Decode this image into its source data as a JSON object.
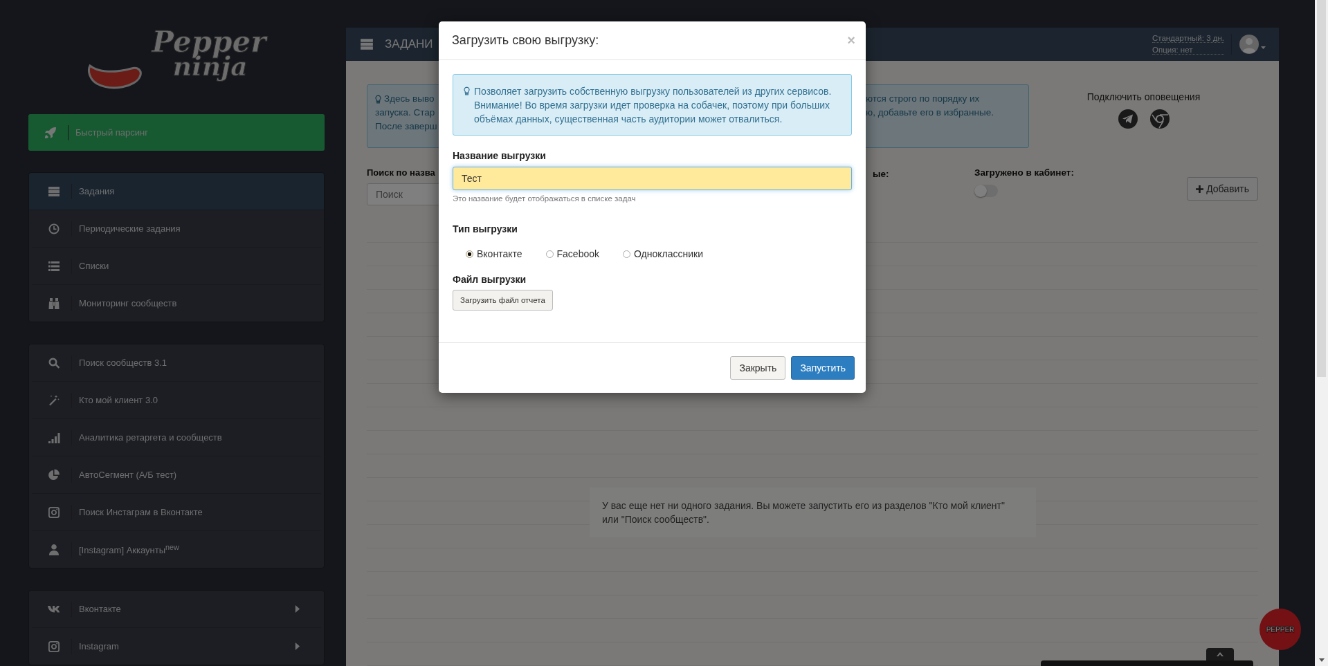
{
  "logo": {
    "line1": "Pepper",
    "line2": "ninja"
  },
  "sidebar": {
    "quick_action": {
      "label": "Быстрый парсинг"
    },
    "groups": [
      {
        "items": [
          {
            "label": "Задания",
            "selected": true
          },
          {
            "label": "Периодические задания",
            "selected": false
          },
          {
            "label": "Списки",
            "selected": false
          },
          {
            "label": "Мониторинг сообществ",
            "selected": false
          }
        ]
      },
      {
        "items": [
          {
            "label": "Поиск сообществ 3.1",
            "selected": false
          },
          {
            "label": "Кто мой клиент 3.0",
            "selected": false
          },
          {
            "label": "Аналитика ретаргета и сообществ",
            "selected": false
          },
          {
            "label": "АвтоСегмент (А/Б тест)",
            "selected": false
          },
          {
            "label": "Поиск Инстаграм в Вконтакте",
            "selected": false
          },
          {
            "label": "[Instagram] Аккаунты$^{new}$",
            "selected": false
          }
        ]
      },
      {
        "items": [
          {
            "label": "Вконтакте",
            "selected": false,
            "expanded": false
          },
          {
            "label": "Instagram",
            "selected": false,
            "expanded": false
          }
        ]
      }
    ]
  },
  "header": {
    "title": "ЗАДАНИ",
    "plan": "Стандартный: 3 дн.",
    "option": "Опция: нет"
  },
  "info_alert": {
    "left_lines": [
      "Здесь выво",
      "запуска. Стар",
      "После заверш"
    ],
    "right_lines": [
      "ются строго по порядку их",
      "ю, добавьте его в избранные."
    ]
  },
  "notifications": {
    "label": "Подключить оповещения"
  },
  "filters": {
    "search_label": "Поиск по назва",
    "search_placeholder": "Поиск",
    "column_2_label": "ые:",
    "cabinet_label": "Загружено в кабинет:",
    "cabinet_toggle": {
      "on": false
    },
    "add_button": "Добавить"
  },
  "empty_message": "У вас еще нет ни одного задания. Вы можете запустить его из разделов \"Кто мой клиент\" или \"Поиск сообществ\".",
  "modal": {
    "title": "Загрузить свою выгрузку:",
    "close": "×",
    "alert": "Позволяет загрузить собственную выгрузку пользователей из других сервисов. Внимание! Во время загрузки идет проверка на собачек, поэтому при больших объёмах данных, существенная часть аудитории может отвалиться.",
    "name_label": "Название выгрузки",
    "name_value": "Тест",
    "name_help": "Это название будет отображаться в списке задач",
    "type_label": "Тип выгрузки",
    "types": [
      {
        "label": "Вконтакте",
        "selected": true
      },
      {
        "label": "Facebook",
        "selected": false
      },
      {
        "label": "Одноклассники",
        "selected": false
      }
    ],
    "file_label": "Файл выгрузки",
    "file_button": "Загрузить файл отчета",
    "buttons": [
      {
        "label": "Закрыть",
        "kind": "default"
      },
      {
        "label": "Запустить",
        "kind": "primary"
      }
    ]
  },
  "widget": {
    "label": "PEPPER"
  }
}
